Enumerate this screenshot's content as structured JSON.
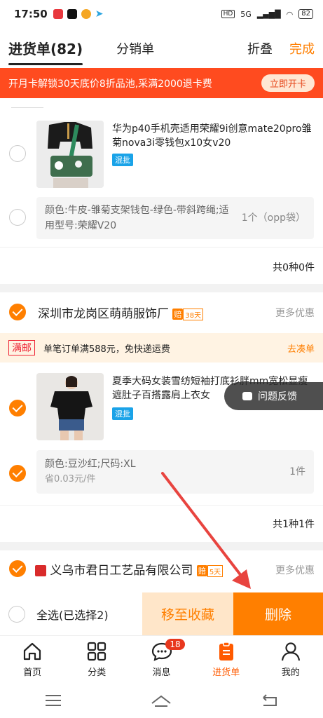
{
  "status": {
    "time": "17:50",
    "signal": "5G",
    "battery": "82"
  },
  "nav": {
    "tab_active": "进货单(82)",
    "tab_other": "分销单",
    "fold": "折叠",
    "done": "完成"
  },
  "promo": {
    "text": "开月卡解锁30天底价8折品池,采满2000退卡费",
    "button": "立即开卡"
  },
  "item1": {
    "title": "华为p40手机壳适用荣耀9i创意mate20pro雏菊nova3i零钱包x10女v20",
    "tag": "混批",
    "sku": "颜色:牛皮-雏菊支架钱包-绿色-带斜跨绳;适用型号:荣耀V20",
    "qty": "1个（opp袋）",
    "subtotal": "共0种0件"
  },
  "shop2": {
    "name": "深圳市龙岗区萌萌服饰厂",
    "badge": "赔",
    "days": "38天",
    "more": "更多优惠",
    "manyou_tag": "满邮",
    "manyou_text": "单笔订单满588元，免快递运费",
    "manyou_go": "去凑单"
  },
  "item2": {
    "title": "夏季大码女装雪纺短袖打底衫胖mm宽松显瘦遮肚子百搭露肩上衣女",
    "tag": "混批",
    "sku": "颜色:豆沙红;尺码:XL",
    "saving": "省0.03元/件",
    "qty": "1件",
    "subtotal": "共1种1件"
  },
  "shop3": {
    "name": "义乌市君日工艺品有限公司",
    "badge": "赔",
    "days": "5天",
    "more": "更多优惠"
  },
  "feedback": "问题反馈",
  "actions": {
    "select_all": "全选(已选择2)",
    "favorite": "移至收藏",
    "delete": "删除"
  },
  "tabbar": {
    "home": "首页",
    "category": "分类",
    "messages": "消息",
    "messages_badge": "18",
    "cart": "进货单",
    "mine": "我的"
  },
  "colors": {
    "accent": "#ff7f00",
    "promo": "#ff4b1f",
    "arrow": "#e8443f"
  }
}
